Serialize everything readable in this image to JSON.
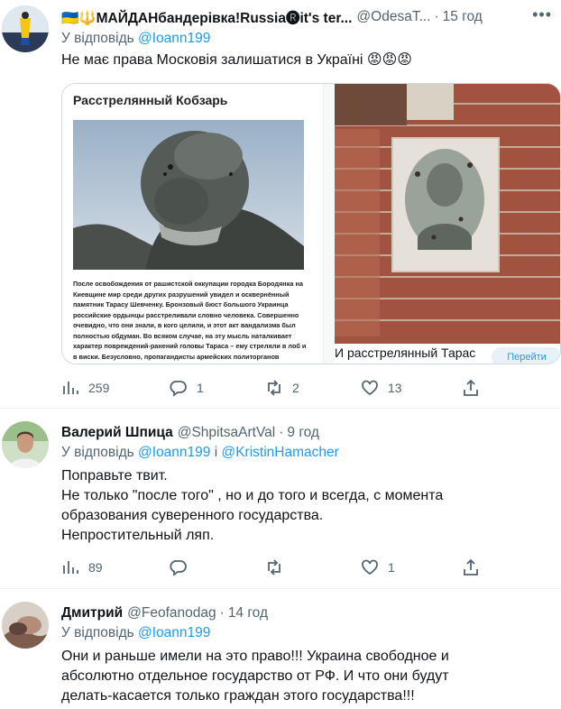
{
  "tweets": [
    {
      "name": "🇺🇦🔱МАЙДАНбандерівка!Russia🅡it's ter...",
      "handle": "@OdesaT...",
      "time": "15 год",
      "reply_prefix": "У відповідь",
      "reply_handles": [
        "@Ioann199"
      ],
      "text": "Не має права Московія залишатися в Україні 😡😡😡",
      "card": {
        "article_title": "Расстрелянный Кобзарь",
        "article_body": "После освобождения от рашистской оккупации городка Бородянка на Киевщине мир среди других разрушений увидел и осквернённый памятник Тарасу Шевченку. Бронзовый бюст большого Украинца российские ордынцы расстреливали словно человека. Совершенно очевидно, что они знали, в кого целили, и этот акт вандализма был полностью обдуман. Во всяком случае, на эту мысль наталкивает характер повреждений-ранений головы Тараса – ему стреляли в лоб и в виски. Безусловно, пропагандисты армейских политорганов предварительно накачали рядовых орков ненавистью и специально",
        "caption": "И расстрелянный Тарас",
        "caption_button": "Перейти"
      },
      "stats": {
        "views": "259",
        "replies": "1",
        "retweets": "2",
        "likes": "13"
      }
    },
    {
      "name": "Валерий Шпица",
      "handle": "@ShpitsaArtVal",
      "time": "9 год",
      "reply_prefix": "У відповідь",
      "reply_handles": [
        "@Ioann199",
        "@KristinHamacher"
      ],
      "reply_joiner": "і",
      "text_lines": [
        "Поправьте твит.",
        "Не только \"после того\" , но и до того и всегда, с момента образования суверенного государства.",
        "Непростительный ляп."
      ],
      "stats": {
        "views": "89",
        "replies": "",
        "retweets": "",
        "likes": "1"
      }
    },
    {
      "name": "Дмитрий",
      "handle": "@Feofanodag",
      "time": "14 год",
      "reply_prefix": "У відповідь",
      "reply_handles": [
        "@Ioann199"
      ],
      "text": "Они и раньше имели на это право!!! Украина свободное и абсолютно отдельное государство от РФ. И что они будут делать-касается только граждан этого государства!!!"
    }
  ],
  "colors": {
    "accent": "#1d9bf0",
    "secondary_text": "#536471",
    "divider": "#eff3f4"
  },
  "icons": [
    "views-icon",
    "reply-icon",
    "retweet-icon",
    "like-icon",
    "share-icon"
  ]
}
